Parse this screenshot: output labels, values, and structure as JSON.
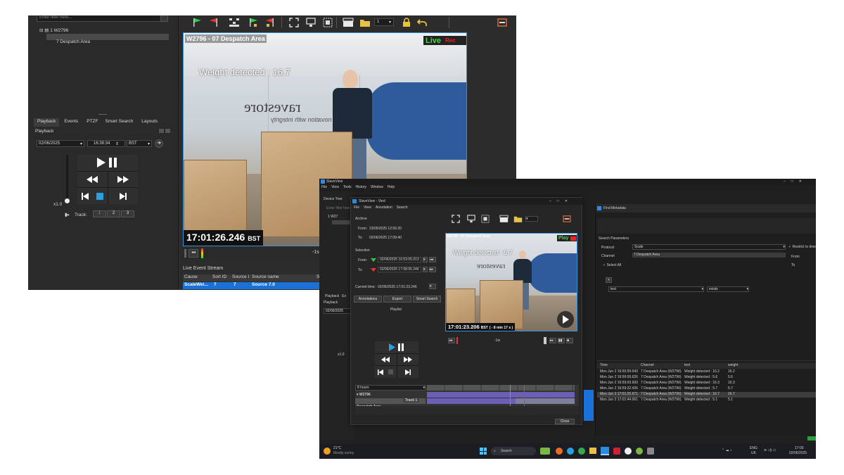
{
  "win1": {
    "filter_placeholder": "Enter filter here...",
    "tree": {
      "site": "1 W2796",
      "camera": "7 Despatch Area"
    },
    "tabs": [
      "Playback",
      "Events",
      "PTZF",
      "Smart Search",
      "Layouts"
    ],
    "section_title": "Playback",
    "date": "02/06/2025",
    "time": "16:39:34",
    "tz": "BST",
    "speed": "x1.0",
    "track_label": "Track:",
    "tracks": [
      "1",
      "2",
      "3"
    ],
    "toolbar_dropdown": "1",
    "video": {
      "title": "W2796 - 07 Despatch Area",
      "live": "Live",
      "rec": "Rec",
      "overlay": "Weight detected : 16.7",
      "timestamp": "17:01:26.246",
      "tz": "BST",
      "wall_text": "ravestore",
      "wall_sub": "novation with integrity"
    },
    "timeline_mark": "-1s",
    "event_stream": {
      "title": "Live Event Stream",
      "headers": [
        "Cause",
        "Sort ID",
        "Source I",
        "Source name",
        "S"
      ],
      "row": [
        "ScaleWei...",
        "7",
        "7",
        "Source 7.0",
        ""
      ]
    }
  },
  "win2": {
    "app_title": "SlaveView",
    "menu": [
      "File",
      "View",
      "Tools",
      "History",
      "Window",
      "Help"
    ],
    "device_tree": "Device Tree",
    "filter_placeholder": "Enter filter here",
    "tree_site": "1 W27",
    "left_tabs": [
      "Playback",
      "Ev"
    ],
    "left_section": "Playback",
    "left_date": "02/06/2025",
    "left_speed": "x1.0",
    "dialog": {
      "title": "SlaveView - Vied",
      "menu": [
        "File",
        "View",
        "Annotation",
        "Search"
      ],
      "archive": "Archive",
      "from_label": "From:",
      "from_value": "23/05/2025 12:56:20",
      "to_label": "To:",
      "to_value": "02/06/2025 17:09:40",
      "selection": "Selection",
      "sel_from_label": "From:",
      "sel_from_value": "02/06/2025 16:53:05.013",
      "sel_to_label": "To:",
      "sel_to_value": "02/06/2025 17:08:55.246",
      "current_label": "Current time:",
      "current_value": "02/06/2025 17:01:23.246",
      "buttons": [
        "Annotations",
        "Export",
        "Smart Search"
      ],
      "playlist": "Playlist",
      "video_title": "W2796 - 07 Despatch Area",
      "video_play": "Play",
      "video_overlay": "Weight detected : 5.7",
      "video_ts": "17:01:23.206",
      "video_tz": "BST",
      "video_offset": "( - 8 min 17 s )",
      "tl_mark": "-1w",
      "tl_range": "8 hours",
      "tl_site": "W2796",
      "tl_camera": "Despatch Area",
      "tl_track": "Track 1",
      "close": "Close"
    },
    "metadata": {
      "title": "Find Metadata",
      "search_params": "Search Parameters",
      "protocol_label": "Protocol",
      "protocol_value": "Scale",
      "restrict": "Restrict to time",
      "channel_label": "Channel",
      "channel_value": "7 Despatch Area",
      "from": "From",
      "to": "To",
      "select_all": "Select All",
      "add": "+",
      "field1": "text",
      "field2": "exists",
      "headers": [
        "Time",
        "Channel",
        "text",
        "weight"
      ],
      "rows": [
        [
          "Mon Jun 2 16:55:59.043",
          "7 Despatch Area (W2796)",
          "Weight detected : 16.2",
          "16.2"
        ],
        [
          "Mon Jun 2 16:56:09.626",
          "7 Despatch Area (W2796)",
          "Weight detected : 5.6",
          "5.6"
        ],
        [
          "Mon Jun 2 16:59:03.693",
          "7 Despatch Area (W2796)",
          "Weight detected : 16.3",
          "16.3"
        ],
        [
          "Mon Jun 2 16:59:22.426",
          "7 Despatch Area (W2796)",
          "Weight detected : 5.7",
          "5.7"
        ],
        [
          "Mon Jun 2 17:01:25.671",
          "7 Despatch Area (W2796)",
          "Weight detected : 16.7",
          "16.7"
        ],
        [
          "Mon Jun 2 17:01:44.061",
          "7 Despatch Area (W2796)",
          "Weight detected : 5.1",
          "5.1"
        ]
      ]
    },
    "taskbar": {
      "temp": "21°C",
      "weather": "Mostly sunny",
      "search": "Search",
      "lang1": "ENG",
      "lang2": "UK",
      "clock": "17:00",
      "date": "02/06/2025"
    }
  }
}
